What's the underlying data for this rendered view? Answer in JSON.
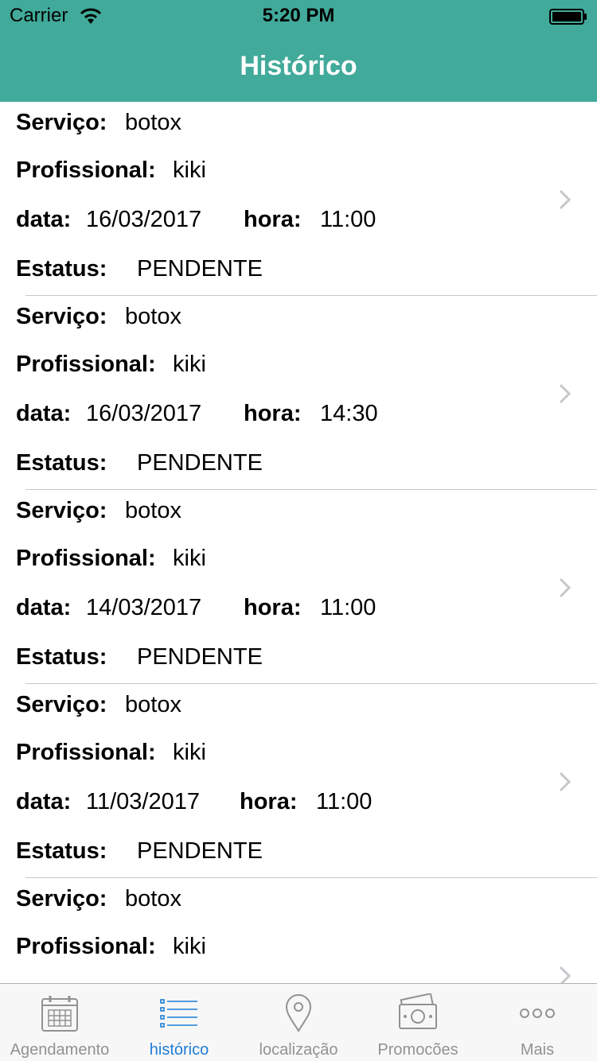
{
  "status_bar": {
    "carrier": "Carrier",
    "time": "5:20 PM"
  },
  "nav": {
    "title": "Histórico"
  },
  "labels": {
    "servico": "Serviço:",
    "profissional": "Profissional:",
    "data": "data:",
    "hora": "hora:",
    "estatus": "Estatus:"
  },
  "rows": [
    {
      "servico": "botox",
      "profissional": "kiki",
      "data": "16/03/2017",
      "hora": "11:00",
      "estatus": "PENDENTE"
    },
    {
      "servico": "botox",
      "profissional": "kiki",
      "data": "16/03/2017",
      "hora": "14:30",
      "estatus": "PENDENTE"
    },
    {
      "servico": "botox",
      "profissional": "kiki",
      "data": "14/03/2017",
      "hora": "11:00",
      "estatus": "PENDENTE"
    },
    {
      "servico": "botox",
      "profissional": "kiki",
      "data": "11/03/2017",
      "hora": "11:00",
      "estatus": "PENDENTE"
    },
    {
      "servico": "botox",
      "profissional": "kiki",
      "data": "",
      "hora": "",
      "estatus": ""
    }
  ],
  "tabs": [
    {
      "label": "Agendamento",
      "icon": "calendar-icon",
      "active": false
    },
    {
      "label": "histórico",
      "icon": "list-icon",
      "active": true
    },
    {
      "label": "localização",
      "icon": "location-pin-icon",
      "active": false
    },
    {
      "label": "Promocões",
      "icon": "money-icon",
      "active": false
    },
    {
      "label": "Mais",
      "icon": "more-icon",
      "active": false
    }
  ],
  "colors": {
    "header": "#41aa9a",
    "tab_active": "#1e7dd8",
    "tab_inactive": "#929292"
  }
}
